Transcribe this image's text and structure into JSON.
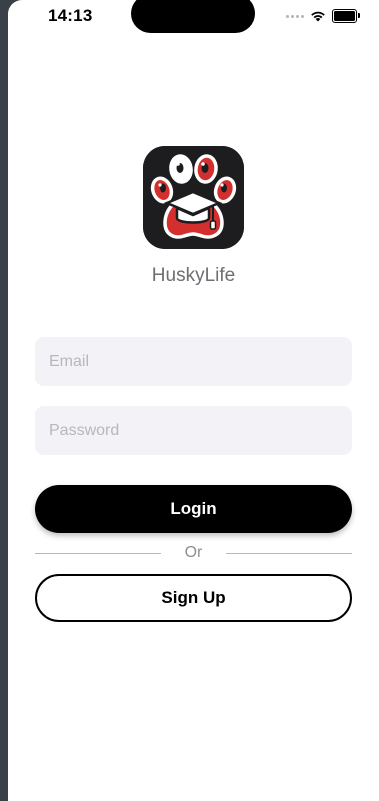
{
  "status_bar": {
    "time": "14:13",
    "icons": [
      "cellular-signal-icon",
      "wifi-icon",
      "battery-icon"
    ]
  },
  "app": {
    "name": "HuskyLife",
    "logo_icon": "paw-graduation-cap-logo",
    "colors": {
      "logo_background": "#1d1d1f",
      "logo_accent": "#d32f2f"
    }
  },
  "login_form": {
    "email_placeholder": "Email",
    "email_value": "",
    "password_placeholder": "Password",
    "password_value": "",
    "login_label": "Login",
    "divider_label": "Or",
    "signup_label": "Sign Up"
  }
}
